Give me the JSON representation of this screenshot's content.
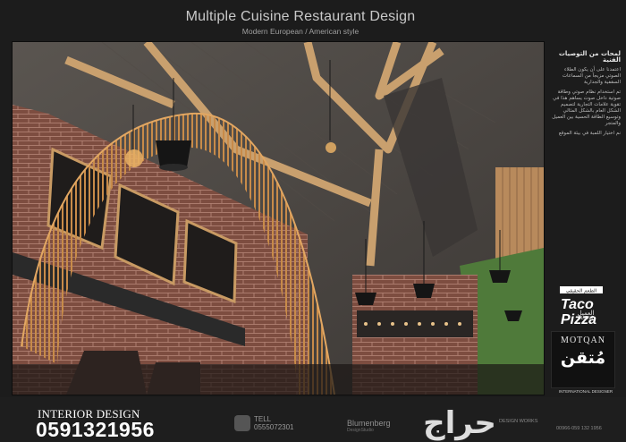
{
  "header": {
    "title": "Multiple Cuisine Restaurant Design",
    "subtitle": "Modern European / American style"
  },
  "side_panel": {
    "heading": "لمحات من التوصيات الفنية",
    "paragraph_1": "اعتمدنا على أن يكون الطلاء الصوتي مزيجاً من السماعات السقفية والجدارية",
    "paragraph_2": "تم استخدام نظام صوتي وطاقة صوتية داخل صوت يساهم هذا في تقوية علامات التجارية لتصميم الشكل العام بالشكل المثالي وتوسيع الطاقة الحسية بين العميل والمتجر",
    "paragraph_3": "نم اختيار اللمبة في بيئة الموقع",
    "client_label_ar": "العميل",
    "client_label_en": "CLIENT",
    "designer_label": "INTERNATIONAL DESIGNER"
  },
  "logos": {
    "taco_top_ar": "الطعم الحقيقي",
    "taco_line1": "Taco",
    "taco_line2": "Pizza",
    "motqan_en": "MOTQAN",
    "motqan_ar": "مُتقن"
  },
  "footer": {
    "interior": "INTERIOR DESIGN",
    "phone": "0591321956",
    "tel_label": "TELL",
    "tel_number": "0555072301",
    "brand": "Blumenberg",
    "brand_sub": "DesignStudio",
    "works": "DESIGN WORKS",
    "bottom_number": "00966-059 132 1956"
  },
  "watermark": {
    "text": "حراج"
  },
  "colors": {
    "background": "#1c1c1c",
    "accent_wood": "#c48a4c",
    "brick": "#9a5a4a",
    "ceiling": "#4a4541"
  }
}
